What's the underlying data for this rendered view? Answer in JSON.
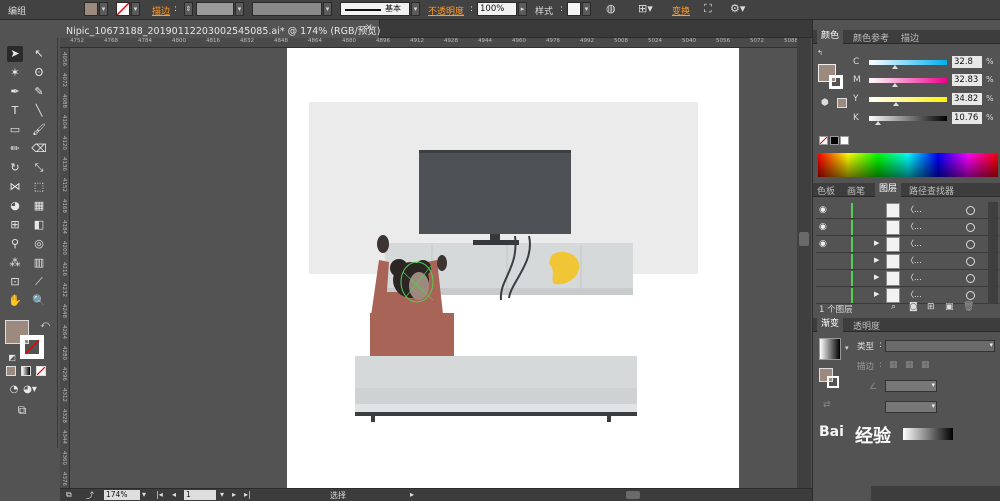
{
  "controlbar": {
    "mode_label": "编组",
    "stroke_label": "描边",
    "stroke_style": "基本",
    "opacity_label": "不透明度",
    "opacity_value": "100%",
    "style_label": "样式",
    "transform_label": "变换",
    "fill_color": "#9c8a7e",
    "accent_color": "#ff9a2a"
  },
  "document": {
    "tab_title": "Nipic_10673188_20190112203002545085.ai* @ 174% (RGB/预览)",
    "close_glyph": "×"
  },
  "rulers": {
    "h_ticks": [
      "4752",
      "4768",
      "4784",
      "4800",
      "4816",
      "4832",
      "4848",
      "4864",
      "4880",
      "4896",
      "4912",
      "4928",
      "4944",
      "4960",
      "4976",
      "4992",
      "5008",
      "5024",
      "5040",
      "5056",
      "5072",
      "5088"
    ],
    "v_ticks": [
      "4056",
      "4072",
      "4088",
      "4104",
      "4120",
      "4136",
      "4152",
      "4168",
      "4184",
      "4200",
      "4216",
      "4232",
      "4248",
      "4264",
      "4280",
      "4296",
      "4312",
      "4328",
      "4344",
      "4360",
      "4376"
    ]
  },
  "status": {
    "zoom": "174%",
    "page": "1",
    "tool_name": "选择"
  },
  "panel_color": {
    "tabs": [
      "颜色",
      "颜色参考",
      "描边"
    ],
    "channels": [
      {
        "label": "C",
        "value": "32.8",
        "fraction": 0.33,
        "from": "#ffffff",
        "to": "#00aeef"
      },
      {
        "label": "M",
        "value": "32.83",
        "fraction": 0.33,
        "from": "#ffffff",
        "to": "#ec008c"
      },
      {
        "label": "Y",
        "value": "34.82",
        "fraction": 0.35,
        "from": "#ffffff",
        "to": "#fff200"
      },
      {
        "label": "K",
        "value": "10.76",
        "fraction": 0.11,
        "from": "#ffffff",
        "to": "#000000"
      }
    ],
    "percent_sign": "%"
  },
  "panel_layers": {
    "tabs": [
      "色板",
      "画笔",
      "图层",
      "路径查找器"
    ],
    "rows": [
      {
        "visible": true,
        "expandable": false,
        "name": "〈..."
      },
      {
        "visible": true,
        "expandable": false,
        "name": "〈..."
      },
      {
        "visible": true,
        "expandable": true,
        "name": "〈..."
      },
      {
        "visible": false,
        "expandable": true,
        "name": "〈..."
      },
      {
        "visible": false,
        "expandable": true,
        "name": "〈..."
      },
      {
        "visible": false,
        "expandable": true,
        "name": "〈..."
      }
    ],
    "footer_count": "1 个图层"
  },
  "panel_gradient": {
    "tabs": [
      "渐变",
      "透明度"
    ],
    "type_label": "类型",
    "stroke_label": "描边"
  },
  "watermark": {
    "text": "经验",
    "prefix": "Bai"
  }
}
